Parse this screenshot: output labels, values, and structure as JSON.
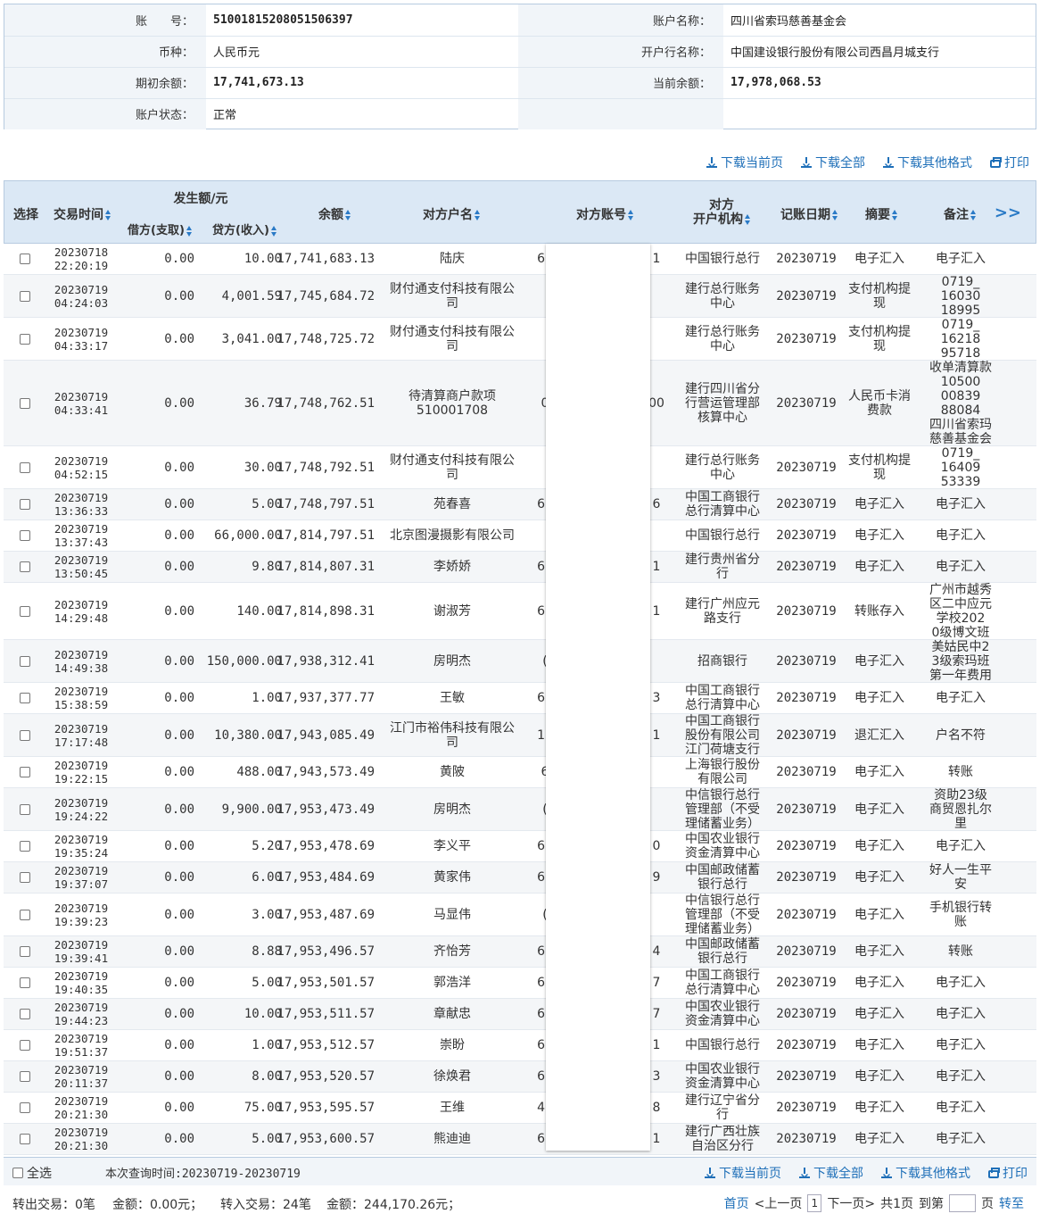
{
  "account": {
    "no_label": "账　　号：",
    "no": "51001815208051506397",
    "name_label": "账户名称：",
    "name": "四川省索玛慈善基金会",
    "currency_label": "币种：",
    "currency": "人民币元",
    "bank_label": "开户行名称：",
    "bank": "中国建设银行股份有限公司西昌月城支行",
    "open_bal_label": "期初余额：",
    "open_bal": "17,741,673.13",
    "cur_bal_label": "当前余额：",
    "cur_bal": "17,978,068.53",
    "status_label": "账户状态：",
    "status": "正常"
  },
  "toolbar": {
    "dl_page": "下载当前页",
    "dl_all": "下载全部",
    "dl_other": "下载其他格式",
    "print": "打印"
  },
  "columns": {
    "select": "选择",
    "time": "交易时间",
    "amount_group": "发生额/元",
    "debit": "借方(支取)",
    "credit": "贷方(收入)",
    "balance": "余额",
    "cp_name": "对方户名",
    "cp_acct": "对方账号",
    "cp_bank": "对方\n开户机构",
    "date": "记账日期",
    "summary": "摘要",
    "remark": "备注",
    "more": ">>"
  },
  "rows": [
    {
      "t1": "20230718",
      "t2": "22:20:19",
      "debit": "0.00",
      "credit": "10.00",
      "bal": "17,741,683.13",
      "name": "陆庆",
      "pre": "60",
      "suf": "1",
      "bank": "中国银行总行",
      "date": "20230719",
      "sum": "电子汇入",
      "rem": "电子汇入"
    },
    {
      "t1": "20230719",
      "t2": "04:24:03",
      "debit": "0.00",
      "credit": "4,001.59",
      "bal": "17,745,684.72",
      "name": "财付通支付科技有限公司",
      "pre": "",
      "suf": "",
      "bank": "建行总行账务中心",
      "date": "20230719",
      "sum": "支付机构提现",
      "rem": "0719_\n16030\n18995"
    },
    {
      "t1": "20230719",
      "t2": "04:33:17",
      "debit": "0.00",
      "credit": "3,041.00",
      "bal": "17,748,725.72",
      "name": "财付通支付科技有限公司",
      "pre": "",
      "suf": "",
      "bank": "建行总行账务中心",
      "date": "20230719",
      "sum": "支付机构提现",
      "rem": "0719_\n16218\n95718"
    },
    {
      "t1": "20230719",
      "t2": "04:33:41",
      "debit": "0.00",
      "credit": "36.79",
      "bal": "17,748,762.51",
      "name": "待清算商户款项510001708",
      "pre": "0",
      "suf": "00",
      "bank": "建行四川省分行营运管理部核算中心",
      "date": "20230719",
      "sum": "人民币卡消费款",
      "rem": "收单清算款\n10500\n00839\n88084\n四川省索玛\n慈善基金会"
    },
    {
      "t1": "20230719",
      "t2": "04:52:15",
      "debit": "0.00",
      "credit": "30.00",
      "bal": "17,748,792.51",
      "name": "财付通支付科技有限公司",
      "pre": "",
      "suf": "",
      "bank": "建行总行账务中心",
      "date": "20230719",
      "sum": "支付机构提现",
      "rem": "0719_\n16409\n53339"
    },
    {
      "t1": "20230719",
      "t2": "13:36:33",
      "debit": "0.00",
      "credit": "5.00",
      "bal": "17,748,797.51",
      "name": "苑春喜",
      "pre": "62",
      "suf": "6",
      "bank": "中国工商银行总行清算中心",
      "date": "20230719",
      "sum": "电子汇入",
      "rem": "电子汇入"
    },
    {
      "t1": "20230719",
      "t2": "13:37:43",
      "debit": "0.00",
      "credit": "66,000.00",
      "bal": "17,814,797.51",
      "name": "北京图漫摄影有限公司",
      "pre": "",
      "suf": "",
      "bank": "中国银行总行",
      "date": "20230719",
      "sum": "电子汇入",
      "rem": "电子汇入"
    },
    {
      "t1": "20230719",
      "t2": "13:50:45",
      "debit": "0.00",
      "credit": "9.80",
      "bal": "17,814,807.31",
      "name": "李娇娇",
      "pre": "62",
      "suf": "1",
      "bank": "建行贵州省分行",
      "date": "20230719",
      "sum": "电子汇入",
      "rem": "电子汇入"
    },
    {
      "t1": "20230719",
      "t2": "14:29:48",
      "debit": "0.00",
      "credit": "140.00",
      "bal": "17,814,898.31",
      "name": "谢淑芳",
      "pre": "62",
      "suf": "1",
      "bank": "建行广州应元路支行",
      "date": "20230719",
      "sum": "转账存入",
      "rem": "广州市越秀\n区二中应元\n学校202\n0级博文班"
    },
    {
      "t1": "20230719",
      "t2": "14:49:38",
      "debit": "0.00",
      "credit": "150,000.00",
      "bal": "17,938,312.41",
      "name": "房明杰",
      "pre": "(",
      "suf": "",
      "bank": "招商银行",
      "date": "20230719",
      "sum": "电子汇入",
      "rem": "美姑民中2\n3级索玛班\n第一年费用"
    },
    {
      "t1": "20230719",
      "t2": "15:38:59",
      "debit": "0.00",
      "credit": "1.00",
      "bal": "17,937,377.77",
      "name": "王敏",
      "pre": "62",
      "suf": "3",
      "bank": "中国工商银行总行清算中心",
      "date": "20230719",
      "sum": "电子汇入",
      "rem": "电子汇入"
    },
    {
      "t1": "20230719",
      "t2": "17:17:48",
      "debit": "0.00",
      "credit": "10,380.00",
      "bal": "17,943,085.49",
      "name": "江门市裕伟科技有限公司",
      "pre": "12",
      "suf": "1",
      "bank": "中国工商银行股份有限公司江门荷塘支行",
      "date": "20230719",
      "sum": "退汇汇入",
      "rem": "户名不符"
    },
    {
      "t1": "20230719",
      "t2": "19:22:15",
      "debit": "0.00",
      "credit": "488.00",
      "bal": "17,943,573.49",
      "name": "黄陂",
      "pre": "6",
      "suf": "",
      "bank": "上海银行股份有限公司",
      "date": "20230719",
      "sum": "电子汇入",
      "rem": "转账"
    },
    {
      "t1": "20230719",
      "t2": "19:24:22",
      "debit": "0.00",
      "credit": "9,900.00",
      "bal": "17,953,473.49",
      "name": "房明杰",
      "pre": "(",
      "suf": "",
      "bank": "中信银行总行管理部（不受理储蓄业务）",
      "date": "20230719",
      "sum": "电子汇入",
      "rem": "资助23级\n商贸恩扎尔\n里"
    },
    {
      "t1": "20230719",
      "t2": "19:35:24",
      "debit": "0.00",
      "credit": "5.20",
      "bal": "17,953,478.69",
      "name": "李义平",
      "pre": "62",
      "suf": "0",
      "bank": "中国农业银行资金清算中心",
      "date": "20230719",
      "sum": "电子汇入",
      "rem": "电子汇入"
    },
    {
      "t1": "20230719",
      "t2": "19:37:07",
      "debit": "0.00",
      "credit": "6.00",
      "bal": "17,953,484.69",
      "name": "黄家伟",
      "pre": "62",
      "suf": "9",
      "bank": "中国邮政储蓄银行总行",
      "date": "20230719",
      "sum": "电子汇入",
      "rem": "好人一生平\n安"
    },
    {
      "t1": "20230719",
      "t2": "19:39:23",
      "debit": "0.00",
      "credit": "3.00",
      "bal": "17,953,487.69",
      "name": "马显伟",
      "pre": "(",
      "suf": "",
      "bank": "中信银行总行管理部（不受理储蓄业务）",
      "date": "20230719",
      "sum": "电子汇入",
      "rem": "手机银行转\n账"
    },
    {
      "t1": "20230719",
      "t2": "19:39:41",
      "debit": "0.00",
      "credit": "8.88",
      "bal": "17,953,496.57",
      "name": "齐怡芳",
      "pre": "62",
      "suf": "4",
      "bank": "中国邮政储蓄银行总行",
      "date": "20230719",
      "sum": "电子汇入",
      "rem": "转账"
    },
    {
      "t1": "20230719",
      "t2": "19:40:35",
      "debit": "0.00",
      "credit": "5.00",
      "bal": "17,953,501.57",
      "name": "郭浩洋",
      "pre": "62",
      "suf": "7",
      "bank": "中国工商银行总行清算中心",
      "date": "20230719",
      "sum": "电子汇入",
      "rem": "电子汇入"
    },
    {
      "t1": "20230719",
      "t2": "19:44:23",
      "debit": "0.00",
      "credit": "10.00",
      "bal": "17,953,511.57",
      "name": "章献忠",
      "pre": "62",
      "suf": "7",
      "bank": "中国农业银行资金清算中心",
      "date": "20230719",
      "sum": "电子汇入",
      "rem": "电子汇入"
    },
    {
      "t1": "20230719",
      "t2": "19:51:37",
      "debit": "0.00",
      "credit": "1.00",
      "bal": "17,953,512.57",
      "name": "崇盼",
      "pre": "62",
      "suf": "1",
      "bank": "中国银行总行",
      "date": "20230719",
      "sum": "电子汇入",
      "rem": "电子汇入"
    },
    {
      "t1": "20230719",
      "t2": "20:11:37",
      "debit": "0.00",
      "credit": "8.00",
      "bal": "17,953,520.57",
      "name": "徐焕君",
      "pre": "62",
      "suf": "3",
      "bank": "中国农业银行资金清算中心",
      "date": "20230719",
      "sum": "电子汇入",
      "rem": "电子汇入"
    },
    {
      "t1": "20230719",
      "t2": "20:21:30",
      "debit": "0.00",
      "credit": "75.00",
      "bal": "17,953,595.57",
      "name": "王维",
      "pre": "43",
      "suf": "8",
      "bank": "建行辽宁省分行",
      "date": "20230719",
      "sum": "电子汇入",
      "rem": "电子汇入"
    },
    {
      "t1": "20230719",
      "t2": "20:21:30",
      "debit": "0.00",
      "credit": "5.00",
      "bal": "17,953,600.57",
      "name": "熊迪迪",
      "pre": "62",
      "suf": "1",
      "bank": "建行广西壮族自治区分行",
      "date": "20230719",
      "sum": "电子汇入",
      "rem": "电子汇入"
    }
  ],
  "footer": {
    "select_all": "全选",
    "query_time": "本次查询时间:20230719-20230719",
    "out_count": "转出交易：0笔",
    "out_amount": "金额：0.00元；",
    "in_count": "转入交易：24笔",
    "in_amount": "金额：244,170.26元；",
    "first": "首页",
    "prev": "<上一页",
    "page": "1",
    "next": "下一页>",
    "total": "共1页",
    "goto": "到第",
    "page_unit": "页",
    "go": "转至"
  }
}
